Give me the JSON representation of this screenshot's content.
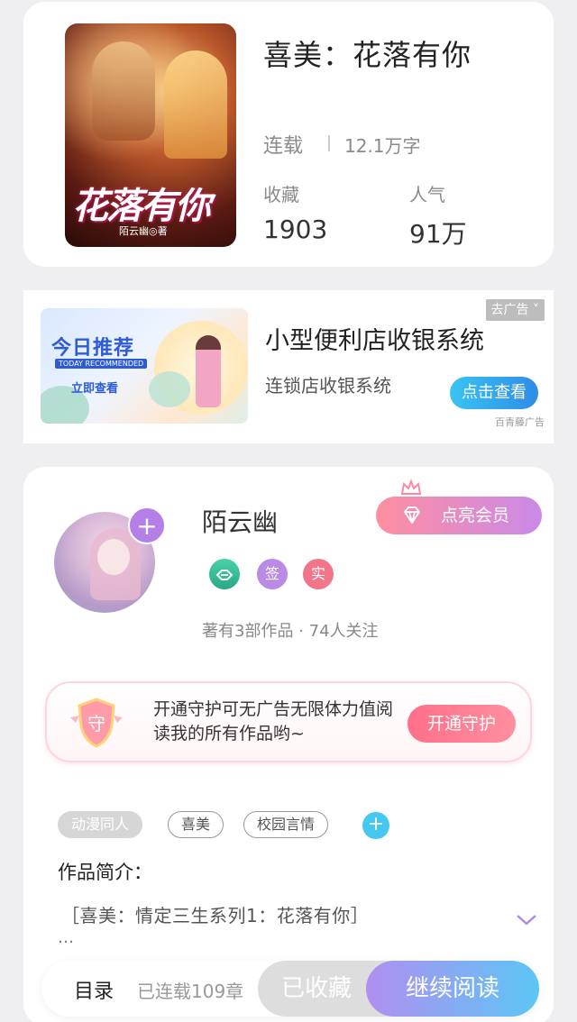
{
  "book": {
    "cover_title": "花落有你",
    "cover_author": "陌云幽◎著",
    "title": "喜美：花落有你",
    "status": "连载",
    "word_count": "12.1万字",
    "favorites_label": "收藏",
    "favorites_value": "1903",
    "popularity_label": "人气",
    "popularity_value": "91万"
  },
  "ad": {
    "image_title": "今日推荐",
    "image_subtitle": "TODAY RECOMMENDED",
    "image_button": "立即查看",
    "title": "小型便利店收银系统",
    "subtitle": "连锁店收银系统",
    "close_label": "去广告 ˅",
    "button_label": "点击查看",
    "source": "百青藤广告"
  },
  "author": {
    "name": "陌云幽",
    "badge_sign": "签",
    "badge_real": "实",
    "meta": "著有3部作品 · 74人关注",
    "vip_button": "点亮会员",
    "follow_symbol": "+"
  },
  "guard": {
    "shield_char": "守",
    "text": "开通守护可无广告无限体力值阅读我的所有作品哟~",
    "button": "开通守护"
  },
  "tags": [
    "动漫同人",
    "喜美",
    "校园言情"
  ],
  "tag_add": "+",
  "intro": {
    "label": "作品简介：",
    "text": "［喜美：情定三生系列1：花落有你］",
    "more": "…"
  },
  "bottom_bar": {
    "toc": "目录",
    "chapter_count": "已连载109章",
    "favorited": "已收藏",
    "continue": "继续阅读"
  },
  "colors": {
    "accent_purple": "#b47fe6",
    "accent_blue": "#2f8ce8",
    "guard_pink": "#ff6f8a"
  }
}
